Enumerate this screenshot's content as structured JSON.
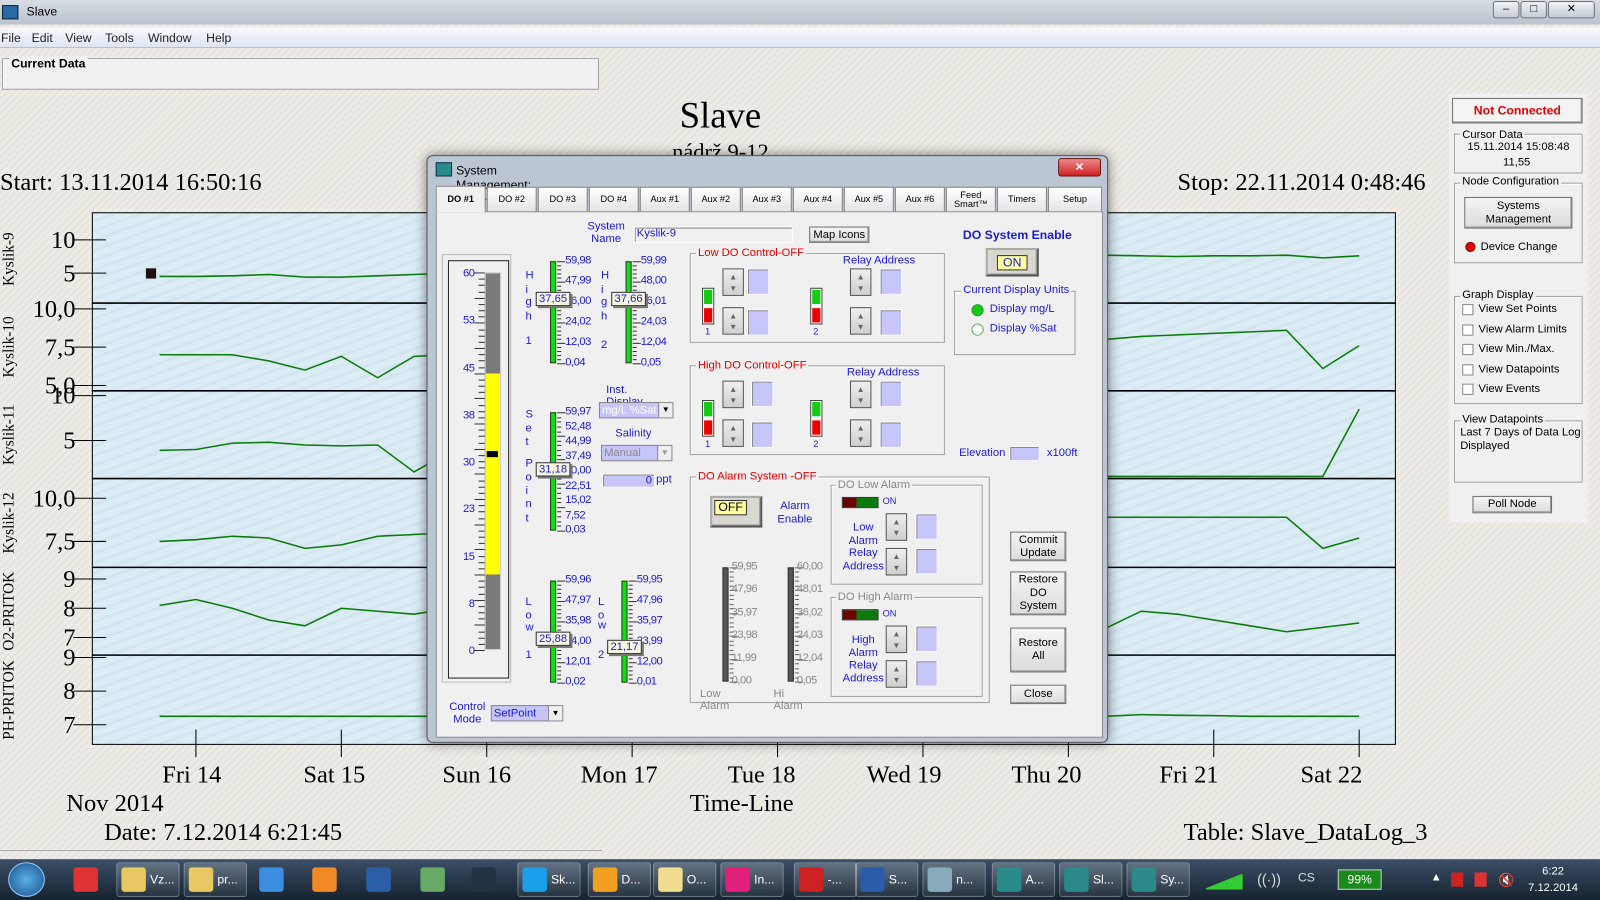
{
  "window": {
    "title": "Slave",
    "menu": [
      "File",
      "Edit",
      "View",
      "Tools",
      "Window",
      "Help"
    ],
    "controls": [
      "–",
      "□",
      "✕"
    ]
  },
  "current_data": {
    "label": "Current Data"
  },
  "header": {
    "title": "Slave",
    "subtitle": "nádrž 9-12",
    "start": "Start: 13.11.2014 16:50:16",
    "stop": "Stop: 22.11.2014 0:48:46"
  },
  "footer": {
    "month": "Nov 2014",
    "axis_title": "Time-Line",
    "date": "Date: 7.12.2014 6:21:45",
    "table": "Table: Slave_DataLog_3"
  },
  "side": {
    "status": "Not Connected",
    "cursor_data": {
      "label": "Cursor Data",
      "time": "15.11.2014 15:08:48",
      "value": "11,55"
    },
    "node_config": {
      "label": "Node Configuration",
      "systems_button": "Systems Management",
      "device_change": "Device Change"
    },
    "graph_display": {
      "label": "Graph Display",
      "options": [
        {
          "label": "View Set Points",
          "checked": false
        },
        {
          "label": "View Alarm Limits",
          "checked": false
        },
        {
          "label": "View Min./Max.",
          "checked": false
        },
        {
          "label": "View Datapoints",
          "checked": false
        },
        {
          "label": "View Events",
          "checked": false
        }
      ]
    },
    "view_datapoints": {
      "label": "View Datapoints",
      "text": "Last 7 Days of Data Log Displayed"
    },
    "poll_button": "Poll Node"
  },
  "dialog": {
    "title": "System Management: Slave",
    "close": "✕",
    "tabs": [
      "DO #1",
      "DO #2",
      "DO #3",
      "DO #4",
      "Aux #1",
      "Aux #2",
      "Aux #3",
      "Aux #4",
      "Aux #5",
      "Aux #6",
      "Feed Smart™",
      "Timers",
      "Setup"
    ],
    "active_tab": "DO #1",
    "system_name_label": "System Name",
    "system_name": "Kyslik-9",
    "map_icons": "Map Icons",
    "do_enable_label": "DO System Enable",
    "do_enable_state": "ON",
    "display_units": {
      "label": "Current Display Units",
      "options": [
        "Display mg/L",
        "Display %Sat"
      ],
      "selected": "Display mg/L"
    },
    "gauge": {
      "scale": [
        "60",
        "53",
        "45",
        "38",
        "30",
        "23",
        "15",
        "8",
        "0"
      ],
      "band": [
        12,
        44
      ],
      "marker": 31.18,
      "max": 60
    },
    "sliders": {
      "high1": {
        "letters": [
          "H",
          "i",
          "g",
          "h",
          "1"
        ],
        "scale": [
          "59,98",
          "47,99",
          "36,00",
          "24,02",
          "12,03",
          "0,04"
        ],
        "thumb": "37,65",
        "value": 37.65
      },
      "high2": {
        "letters": [
          "H",
          "i",
          "g",
          "h",
          "2"
        ],
        "scale": [
          "59,99",
          "48,00",
          "36,01",
          "24,03",
          "12,04",
          "0,05"
        ],
        "thumb": "37,66",
        "value": 37.66
      },
      "setpoint": {
        "letters": [
          "S",
          "e",
          "t",
          "P",
          "o",
          "i",
          "n",
          "t"
        ],
        "scale": [
          "59,97",
          "52,48",
          "44,99",
          "37,49",
          "30,00",
          "22,51",
          "15,02",
          "7,52",
          "0,03"
        ],
        "thumb": "31,18",
        "value": 31.18
      },
      "low1": {
        "letters": [
          "L",
          "o",
          "w",
          "1"
        ],
        "scale": [
          "59,96",
          "47,97",
          "35,98",
          "24,00",
          "12,01",
          "0,02"
        ],
        "thumb": "25,88",
        "value": 25.88
      },
      "low2": {
        "letters": [
          "L",
          "o",
          "w",
          "2"
        ],
        "scale": [
          "59,95",
          "47,96",
          "35,97",
          "23,99",
          "12,00",
          "0,01"
        ],
        "thumb": "21,17",
        "value": 21.17
      },
      "alarm_low": {
        "scale": [
          "59,95",
          "47,96",
          "35,97",
          "23,98",
          "11,99",
          "0,00"
        ],
        "label": "Low Alarm"
      },
      "alarm_high": {
        "scale": [
          "60,00",
          "48,01",
          "36,02",
          "24,03",
          "12,04",
          "0,05"
        ],
        "label": "Hi Alarm"
      }
    },
    "inst_display": {
      "label": "Inst. Display",
      "value": "mg/L %Sat"
    },
    "salinity": {
      "label": "Salinity",
      "mode": "Manual",
      "value": "0",
      "unit": "ppt"
    },
    "control_mode": {
      "label": "Control Mode",
      "value": "SetPoint"
    },
    "low_do": {
      "label": "Low DO Control-OFF",
      "relay_label": "Relay Address",
      "relays": [
        "1",
        "2"
      ]
    },
    "high_do": {
      "label": "High DO Control-OFF",
      "relay_label": "Relay Address",
      "relays": [
        "1",
        "2"
      ]
    },
    "elevation": {
      "label": "Elevation",
      "unit": "x100ft",
      "value": ""
    },
    "alarm": {
      "label": "DO Alarm System -OFF",
      "state": "OFF",
      "enable_label": "Alarm Enable",
      "low": {
        "label": "DO Low Alarm",
        "led": "ON",
        "relay_label": "Low Alarm Relay Address"
      },
      "high": {
        "label": "DO High Alarm",
        "led": "ON",
        "relay_label": "High Alarm Relay Address"
      }
    },
    "buttons": {
      "commit": "Commit Update",
      "restore_do": "Restore DO System",
      "restore_all": "Restore All",
      "close": "Close"
    }
  },
  "taskbar": {
    "items": [
      {
        "label": "",
        "icon": "chrome-icon",
        "color": "#d33"
      },
      {
        "label": "Vz...",
        "icon": "folder-icon",
        "color": "#e8c860"
      },
      {
        "label": "pr...",
        "icon": "folder-icon",
        "color": "#e8c860"
      },
      {
        "label": "",
        "icon": "ie-icon",
        "color": "#3a8de0"
      },
      {
        "label": "",
        "icon": "media-icon",
        "color": "#f08a24"
      },
      {
        "label": "",
        "icon": "ysi-icon",
        "color": "#2a5ea8"
      },
      {
        "label": "",
        "icon": "card-reader-icon",
        "color": "#6a6"
      },
      {
        "label": "",
        "icon": "most-icon",
        "color": "#234"
      },
      {
        "label": "Sk...",
        "icon": "skype-icon",
        "color": "#1aa0e8"
      },
      {
        "label": "D...",
        "icon": "outlook-icon",
        "color": "#f0a020"
      },
      {
        "label": "O...",
        "icon": "mail-icon",
        "color": "#f2dc90"
      },
      {
        "label": "In...",
        "icon": "t-mobile-icon",
        "color": "#e0207a"
      },
      {
        "label": "-...",
        "icon": "pdf-icon",
        "color": "#c22"
      },
      {
        "label": "S...",
        "icon": "word-icon",
        "color": "#2a5caa"
      },
      {
        "label": "n...",
        "icon": "paint-icon",
        "color": "#8ab"
      },
      {
        "label": "A...",
        "icon": "ysi-icon",
        "color": "#2a8a8a"
      },
      {
        "label": "Sl...",
        "icon": "ysi-icon",
        "color": "#2a8a8a"
      },
      {
        "label": "Sy...",
        "icon": "ysi-icon",
        "color": "#2a8a8a"
      }
    ],
    "lang": "CS",
    "battery": "99%",
    "time": "6:22",
    "date": "7.12.2014"
  },
  "chart_data": {
    "type": "line",
    "title": "Slave",
    "xlabel": "Time-Line",
    "x_month_label": "Nov 2014",
    "xlim": [
      "2014-11-13 06:49",
      "2014-11-22 06:03"
    ],
    "x_ticks": [
      {
        "label": "Fri 14",
        "date": "2014-11-14 00:00"
      },
      {
        "label": "Sat 15",
        "date": "2014-11-15 00:00"
      },
      {
        "label": "Sun 16",
        "date": "2014-11-16 00:00"
      },
      {
        "label": "Mon 17",
        "date": "2014-11-17 00:00"
      },
      {
        "label": "Tue 18",
        "date": "2014-11-18 00:00"
      },
      {
        "label": "Wed 19",
        "date": "2014-11-19 00:00"
      },
      {
        "label": "Thu 20",
        "date": "2014-11-20 00:00"
      },
      {
        "label": "Fri 21",
        "date": "2014-11-21 00:00"
      },
      {
        "label": "Sat 22",
        "date": "2014-11-22 00:00"
      }
    ],
    "x": [
      "2014-11-13 18:00",
      "2014-11-14 00:00",
      "2014-11-14 06:00",
      "2014-11-14 12:00",
      "2014-11-14 18:00",
      "2014-11-15 00:00",
      "2014-11-15 06:00",
      "2014-11-15 12:00",
      "2014-11-15 18:00",
      "2014-11-16 00:00",
      "2014-11-16 06:00",
      "2014-11-16 12:00",
      "2014-11-16 18:00",
      "2014-11-17 00:00",
      "2014-11-17 06:00",
      "2014-11-17 12:00",
      "2014-11-17 18:00",
      "2014-11-18 00:00",
      "2014-11-18 06:00",
      "2014-11-18 12:00",
      "2014-11-18 18:00",
      "2014-11-19 00:00",
      "2014-11-19 06:00",
      "2014-11-19 12:00",
      "2014-11-19 18:00",
      "2014-11-20 00:00",
      "2014-11-20 06:00",
      "2014-11-20 12:00",
      "2014-11-20 18:00",
      "2014-11-21 00:00",
      "2014-11-21 06:00",
      "2014-11-21 12:00",
      "2014-11-21 18:00",
      "2014-11-22 00:00"
    ],
    "grid": false,
    "line_color": "#0a7a0a",
    "panels": [
      {
        "name": "Kyslik-9",
        "ylim": [
          0.5,
          13.7
        ],
        "yticks": [
          {
            "label": "10",
            "value": 10
          },
          {
            "label": "5",
            "value": 5
          }
        ],
        "values": [
          4.5,
          4.5,
          4.6,
          4.8,
          4.4,
          4.4,
          4.6,
          4.8,
          5.0,
          5.3,
          5.6,
          5.9,
          6.2,
          6.5,
          6.7,
          6.9,
          7.0,
          7.1,
          7.2,
          7.3,
          7.4,
          7.4,
          7.5,
          7.5,
          7.6,
          7.6,
          7.7,
          7.6,
          7.5,
          7.6,
          7.6,
          7.7,
          7.3,
          7.6
        ]
      },
      {
        "name": "Kyslik-10",
        "ylim": [
          4.65,
          10.38
        ],
        "yticks": [
          {
            "label": "10,0",
            "value": 10
          },
          {
            "label": "7,5",
            "value": 7.5
          },
          {
            "label": "5,0",
            "value": 5
          }
        ],
        "values": [
          7.0,
          7.0,
          7.0,
          6.6,
          6.0,
          6.9,
          5.5,
          6.9,
          7.0,
          7.1,
          7.1,
          7.2,
          7.3,
          7.3,
          7.4,
          7.4,
          7.5,
          7.5,
          7.6,
          7.6,
          7.7,
          7.7,
          7.8,
          7.8,
          7.9,
          7.9,
          8.0,
          8.2,
          8.3,
          8.4,
          8.5,
          8.6,
          6.1,
          7.6
        ]
      },
      {
        "name": "Kyslik-11",
        "ylim": [
          0.76,
          10.53
        ],
        "yticks": [
          {
            "label": "10",
            "value": 10
          },
          {
            "label": "5",
            "value": 5
          }
        ],
        "values": [
          3.9,
          4.0,
          4.7,
          4.8,
          4.5,
          4.4,
          4.5,
          1.5,
          3.8,
          3.8,
          3.7,
          3.6,
          3.5,
          3.3,
          3.1,
          2.9,
          2.7,
          2.5,
          2.3,
          2.1,
          1.9,
          1.7,
          1.5,
          1.3,
          1.2,
          1.1,
          1.0,
          1.0,
          1.0,
          1.0,
          1.0,
          1.0,
          1.0,
          8.5
        ]
      },
      {
        "name": "Kyslik-12",
        "ylim": [
          6.0,
          11.14
        ],
        "yticks": [
          {
            "label": "10,0",
            "value": 10
          },
          {
            "label": "7,5",
            "value": 7.5
          }
        ],
        "values": [
          7.5,
          7.6,
          7.8,
          7.7,
          7.1,
          7.3,
          7.8,
          7.9,
          8.0,
          8.1,
          8.2,
          8.3,
          8.3,
          8.4,
          8.4,
          8.5,
          8.5,
          8.6,
          8.6,
          8.7,
          8.7,
          8.7,
          8.8,
          8.8,
          8.8,
          8.9,
          8.9,
          8.9,
          8.9,
          8.9,
          8.9,
          8.9,
          7.1,
          7.7
        ]
      },
      {
        "name": "O2-PRITOK",
        "ylim": [
          6.4,
          9.4
        ],
        "yticks": [
          {
            "label": "9",
            "value": 9
          },
          {
            "label": "8",
            "value": 8
          },
          {
            "label": "7",
            "value": 7
          }
        ],
        "values": [
          8.1,
          8.3,
          8.0,
          7.6,
          7.4,
          8.0,
          7.9,
          7.8,
          8.0,
          7.9,
          7.8,
          7.8,
          7.7,
          7.6,
          7.6,
          7.5,
          7.5,
          7.4,
          7.4,
          7.4,
          7.3,
          7.3,
          7.3,
          7.3,
          7.3,
          7.3,
          7.3,
          7.9,
          7.8,
          7.6,
          7.4,
          7.2,
          7.35,
          7.5
        ]
      },
      {
        "name": "PH-PRITOK",
        "ylim": [
          6.4,
          9.07
        ],
        "yticks": [
          {
            "label": "9",
            "value": 9
          },
          {
            "label": "8",
            "value": 8
          },
          {
            "label": "7",
            "value": 7
          }
        ],
        "values": [
          7.25,
          7.25,
          7.25,
          7.25,
          7.25,
          7.25,
          7.25,
          7.25,
          7.25,
          7.25,
          7.25,
          7.25,
          7.25,
          7.25,
          7.25,
          7.25,
          7.25,
          7.25,
          7.25,
          7.25,
          7.25,
          7.25,
          7.25,
          7.25,
          7.25,
          7.25,
          7.25,
          7.3,
          7.28,
          7.27,
          7.25,
          7.25,
          7.25,
          7.25
        ]
      }
    ]
  }
}
